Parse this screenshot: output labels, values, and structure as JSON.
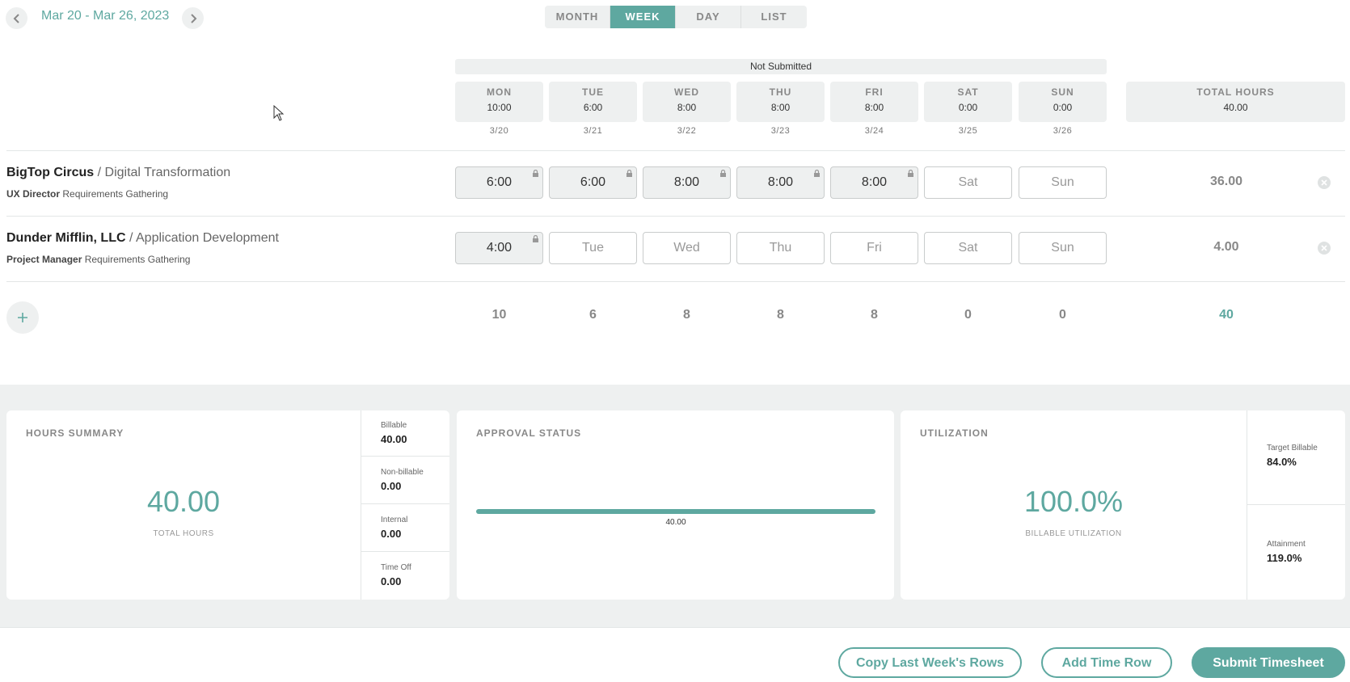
{
  "header": {
    "date_range": "Mar 20 - Mar 26, 2023",
    "views": [
      "MONTH",
      "WEEK",
      "DAY",
      "LIST"
    ],
    "active_view": "WEEK"
  },
  "status": "Not Submitted",
  "days": [
    {
      "name": "MON",
      "hours": "10:00",
      "date": "3/20"
    },
    {
      "name": "TUE",
      "hours": "6:00",
      "date": "3/21"
    },
    {
      "name": "WED",
      "hours": "8:00",
      "date": "3/22"
    },
    {
      "name": "THU",
      "hours": "8:00",
      "date": "3/23"
    },
    {
      "name": "FRI",
      "hours": "8:00",
      "date": "3/24"
    },
    {
      "name": "SAT",
      "hours": "0:00",
      "date": "3/25"
    },
    {
      "name": "SUN",
      "hours": "0:00",
      "date": "3/26"
    }
  ],
  "total_header": {
    "label": "TOTAL HOURS",
    "value": "40.00"
  },
  "rows": [
    {
      "client": "BigTop Circus",
      "separator": "/",
      "project": "Digital Transformation",
      "role": "UX Director",
      "task": "Requirements Gathering",
      "cells": [
        {
          "text": "6:00",
          "locked": true
        },
        {
          "text": "6:00",
          "locked": true
        },
        {
          "text": "8:00",
          "locked": true
        },
        {
          "text": "8:00",
          "locked": true
        },
        {
          "text": "8:00",
          "locked": true
        },
        {
          "text": "Sat",
          "locked": false
        },
        {
          "text": "Sun",
          "locked": false
        }
      ],
      "total": "36.00"
    },
    {
      "client": "Dunder Mifflin, LLC",
      "separator": "/",
      "project": "Application Development",
      "role": "Project Manager",
      "task": "Requirements Gathering",
      "cells": [
        {
          "text": "4:00",
          "locked": true
        },
        {
          "text": "Tue",
          "locked": false
        },
        {
          "text": "Wed",
          "locked": false
        },
        {
          "text": "Thu",
          "locked": false
        },
        {
          "text": "Fri",
          "locked": false
        },
        {
          "text": "Sat",
          "locked": false
        },
        {
          "text": "Sun",
          "locked": false
        }
      ],
      "total": "4.00"
    }
  ],
  "column_totals": [
    "10",
    "6",
    "8",
    "8",
    "8",
    "0",
    "0"
  ],
  "grand_total": "40",
  "hours_summary": {
    "title": "HOURS SUMMARY",
    "total": "40.00",
    "total_caption": "TOTAL HOURS",
    "items": [
      {
        "label": "Billable",
        "value": "40.00"
      },
      {
        "label": "Non-billable",
        "value": "0.00"
      },
      {
        "label": "Internal",
        "value": "0.00"
      },
      {
        "label": "Time Off",
        "value": "0.00"
      }
    ]
  },
  "approval_status": {
    "title": "APPROVAL STATUS",
    "bar_label": "40.00",
    "progress_fraction": 1.0
  },
  "utilization": {
    "title": "UTILIZATION",
    "value": "100.0%",
    "caption": "BILLABLE UTILIZATION",
    "items": [
      {
        "label": "Target Billable",
        "value": "84.0%"
      },
      {
        "label": "Attainment",
        "value": "119.0%"
      }
    ]
  },
  "footer": {
    "copy_label": "Copy Last Week's Rows",
    "add_label": "Add Time Row",
    "submit_label": "Submit Timesheet"
  },
  "colors": {
    "accent": "#5ea8a0",
    "panel": "#eef0f0"
  }
}
